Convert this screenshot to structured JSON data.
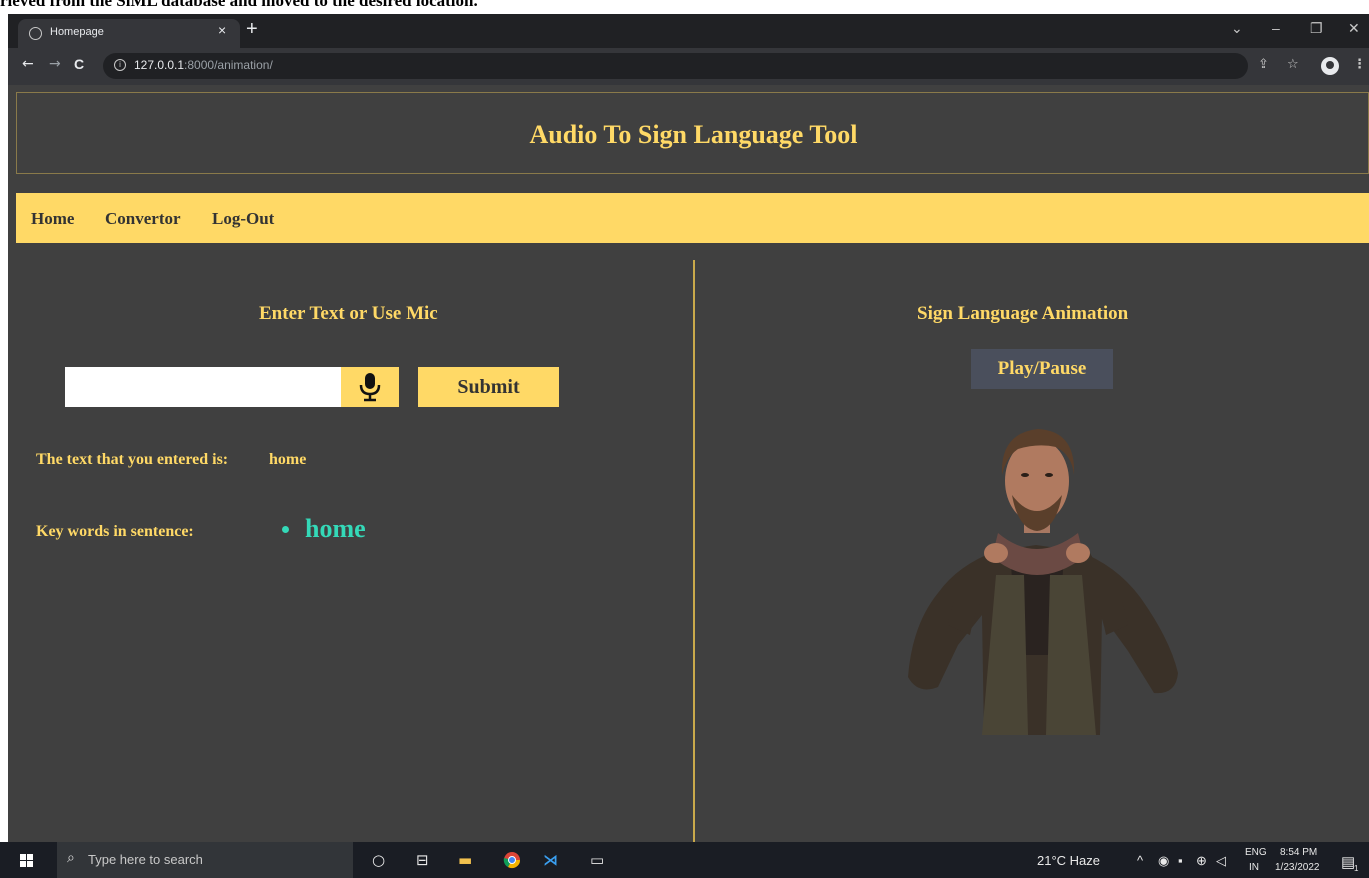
{
  "caption_fragment": "rieved from the SiML database and moved to the desired location.",
  "browser": {
    "tab_title": "Homepage",
    "tab_close": "×",
    "new_tab": "+",
    "url_host": "127.0.0.1",
    "url_rest": ":8000/animation/",
    "window_controls": {
      "dropdown": "⌄",
      "minimize": "–",
      "restore": "❐",
      "close": "✕"
    },
    "nav": {
      "back": "←",
      "forward": "→",
      "reload": "C"
    },
    "share": "⇪",
    "star": "☆",
    "menu": "⋮"
  },
  "page": {
    "title": "Audio To Sign Language Tool",
    "nav": [
      "Home",
      "Convertor",
      "Log-Out"
    ],
    "left": {
      "heading": "Enter Text or Use Mic",
      "input_value": "",
      "submit_label": "Submit",
      "entered_label": "The text that you entered is:",
      "entered_value": "home",
      "keywords_label": "Key words in sentence:",
      "keywords": [
        "home"
      ]
    },
    "right": {
      "heading": "Sign Language Animation",
      "play_label": "Play/Pause"
    }
  },
  "taskbar": {
    "search_placeholder": "Type here to search",
    "weather": "21°C  Haze",
    "lang_top": "ENG",
    "lang_bottom": "IN",
    "time": "8:54 PM",
    "date": "1/23/2022",
    "notification_count": "1"
  },
  "colors": {
    "accent": "#ffd966",
    "keyword": "#34d9b8",
    "page_bg": "#404040"
  }
}
